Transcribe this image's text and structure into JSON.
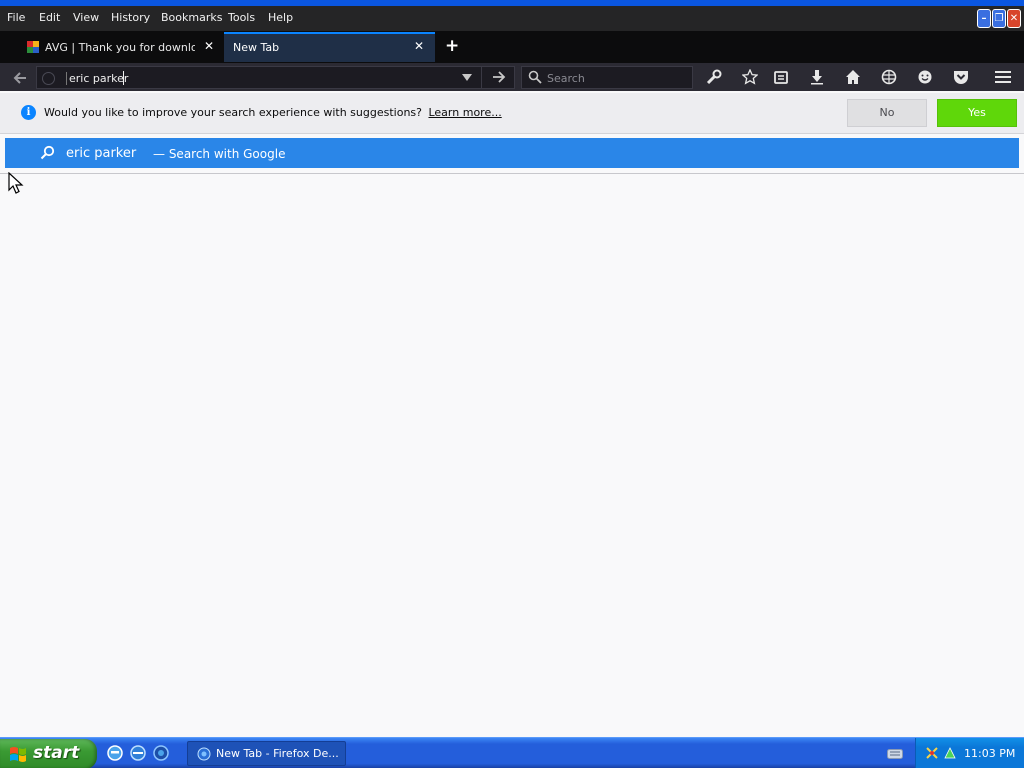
{
  "menubar": {
    "items": [
      "File",
      "Edit",
      "View",
      "History",
      "Bookmarks",
      "Tools",
      "Help"
    ]
  },
  "window_controls": {
    "minimize": "–",
    "restore": "❐",
    "close": "✕"
  },
  "tabs": [
    {
      "title": "AVG | Thank you for downloa...",
      "close": "✕",
      "active": false
    },
    {
      "title": "New Tab",
      "close": "✕",
      "active": true
    }
  ],
  "new_tab": "+",
  "navbar": {
    "url_value": "eric parker",
    "search_placeholder": "Search"
  },
  "notification": {
    "message": "Would you like to improve your search experience with suggestions?",
    "link": "Learn more...",
    "no_label": "No",
    "yes_label": "Yes"
  },
  "autocomplete": {
    "term": "eric parker",
    "action": "— Search with Google"
  },
  "taskbar": {
    "start_label": "start",
    "task_label": "New Tab - Firefox De...",
    "clock": "11:03 PM"
  },
  "colors": {
    "accent": "#0a84ff",
    "autocomplete_highlight": "#2a86e8",
    "yes_button": "#5fd70a",
    "taskbar": "#245edb",
    "start_button": "#3a9a33"
  }
}
